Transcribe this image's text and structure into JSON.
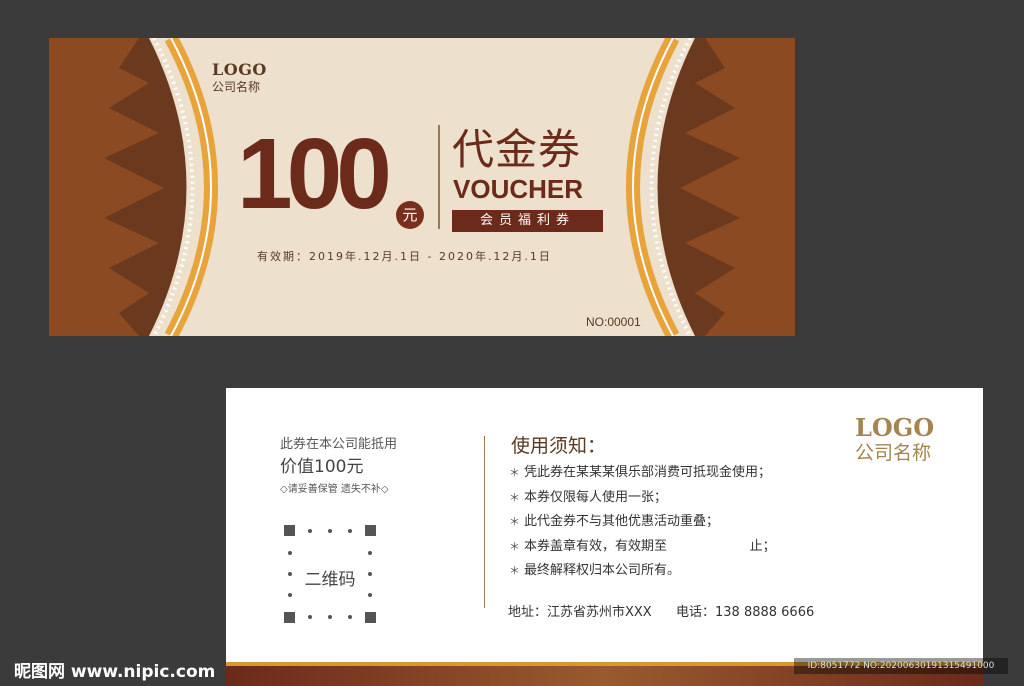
{
  "front": {
    "logo": "LOGO",
    "company": "公司名称",
    "amount": "100",
    "currency": "元",
    "title_cn": "代金券",
    "title_en": "VOUCHER",
    "tag": "会员福利券",
    "validity": "有效期：2019年.12月.1日 - 2020年.12月.1日",
    "serial": "NO:00001"
  },
  "back": {
    "line1": "此券在本公司能抵用",
    "line2": "价值100元",
    "note": "◇请妥善保管 遗失不补◇",
    "qr_label": "二维码",
    "notice_title": "使用须知：",
    "notices": [
      "凭此券在某某某俱乐部消费可抵现金使用；",
      "本券仅限每人使用一张；",
      "此代金券不与其他优惠活动重叠；",
      "本券盖章有效，有效期至                    止；",
      "最终解释权归本公司所有。"
    ],
    "address": "地址：江苏省苏州市XXX",
    "phone": "电话：138 8888 6666",
    "logo": "LOGO",
    "company": "公司名称"
  },
  "watermark": {
    "site": "昵图网 www.nipic.com",
    "id": "ID:8051772 NO:20200630191315491000"
  },
  "colors": {
    "background": "#3b3b3b",
    "card_front": "#ede0cd",
    "brown": "#6b2a1a",
    "gold": "#e8a33a",
    "logo_gold": "#a5854f"
  }
}
